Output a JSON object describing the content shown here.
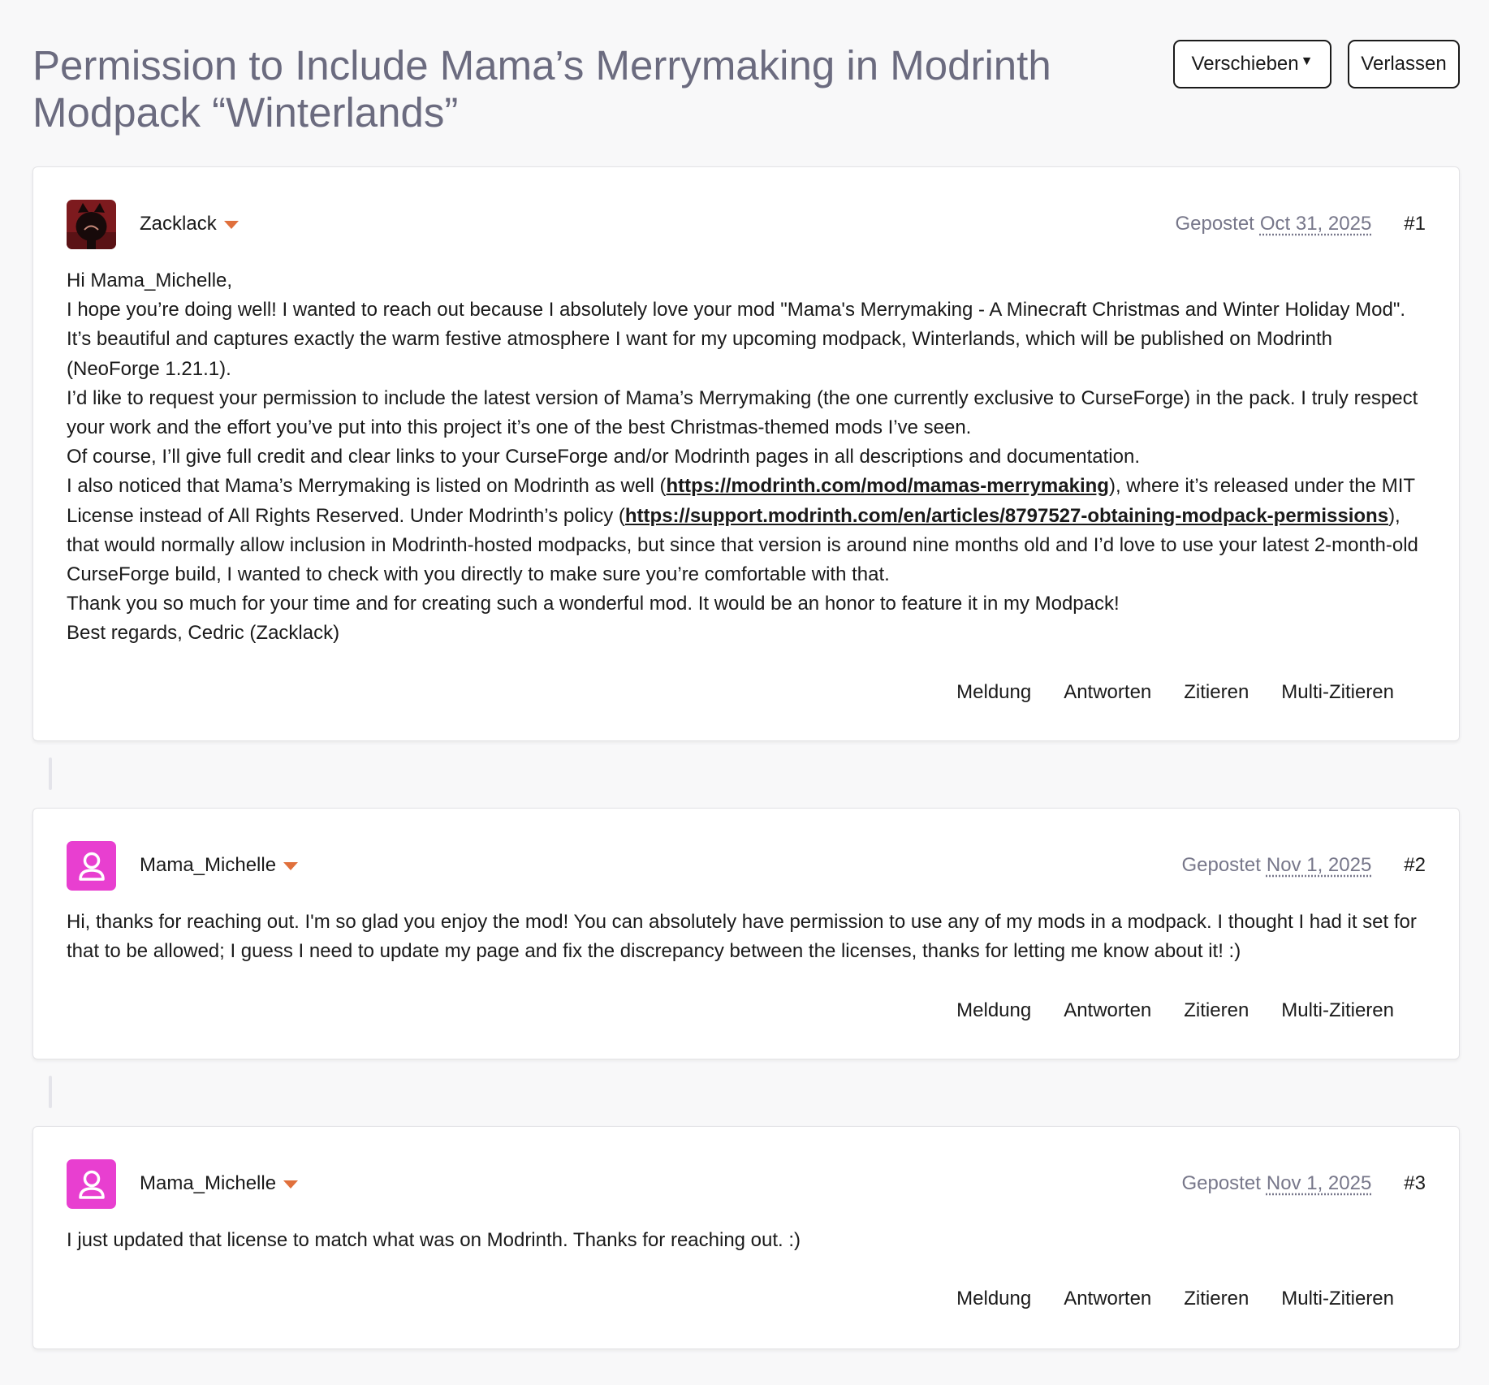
{
  "header": {
    "title": "Permission to Include Mama’s Merrymaking in Modrinth Modpack “Winterlands”",
    "move_label": "Verschieben",
    "leave_label": "Verlassen"
  },
  "colors": {
    "accent_caret": "#e0703c",
    "avatar_pink": "#e83fd0",
    "title_gray": "#6b6b7f"
  },
  "posts": [
    {
      "author": "Zacklack",
      "posted_label": "Gepostet",
      "date": "Oct 31, 2025",
      "number": "#1",
      "avatar_icon": "cat-avatar",
      "paragraphs": [
        "Hi Mama_Michelle,",
        "I hope you’re doing well! I wanted to reach out because I absolutely love your mod \"Mama's Merrymaking - A Minecraft Christmas and Winter Holiday Mod\". It’s beautiful and captures exactly the warm festive atmosphere I want for my upcoming modpack, Winterlands, which will be published on Modrinth (NeoForge 1.21.1).",
        "I’d like to request your permission to include the latest version of Mama’s Merrymaking (the one currently exclusive to CurseForge) in the pack. I truly respect your work and the effort you’ve put into this project it’s one of the best Christmas-themed mods I’ve seen.",
        "Of course, I’ll give full credit and clear links to your CurseForge and/or Modrinth pages in all descriptions and documentation."
      ],
      "p5_pre": "I also noticed that Mama’s Merrymaking is listed on Modrinth as well (",
      "link1": "https://modrinth.com/mod/mamas-merrymaking",
      "p5_mid": "), where it’s released under the MIT License instead of All Rights Reserved. Under Modrinth’s policy (",
      "link2": "https://support.modrinth.com/en/articles/8797527-obtaining-modpack-permissions",
      "p5_post": "), that would normally allow inclusion in Modrinth-hosted modpacks, but since that version is around nine months old and I’d love to use your latest 2-month-old CurseForge build, I wanted to check with you directly to make sure you’re comfortable with that.",
      "p6": "Thank you so much for your time and for creating such a wonderful mod. It would be an honor to feature it in my Modpack!",
      "p7": "Best regards, Cedric (Zacklack)"
    },
    {
      "author": "Mama_Michelle",
      "posted_label": "Gepostet",
      "date": "Nov 1, 2025",
      "number": "#2",
      "avatar_icon": "user-icon",
      "body": "Hi, thanks for reaching out. I'm so glad you enjoy the mod! You can absolutely have permission to use any of my mods in a modpack. I thought I had it set for that to be allowed; I guess I need to update my page and fix the discrepancy between the licenses, thanks for letting me know about it! :)"
    },
    {
      "author": "Mama_Michelle",
      "posted_label": "Gepostet",
      "date": "Nov 1, 2025",
      "number": "#3",
      "avatar_icon": "user-icon",
      "body": "I just updated that license to match what was on Modrinth. Thanks for reaching out. :)"
    }
  ],
  "actions": {
    "report": "Meldung",
    "reply": "Antworten",
    "quote": "Zitieren",
    "multi_quote": "Multi-Zitieren"
  }
}
